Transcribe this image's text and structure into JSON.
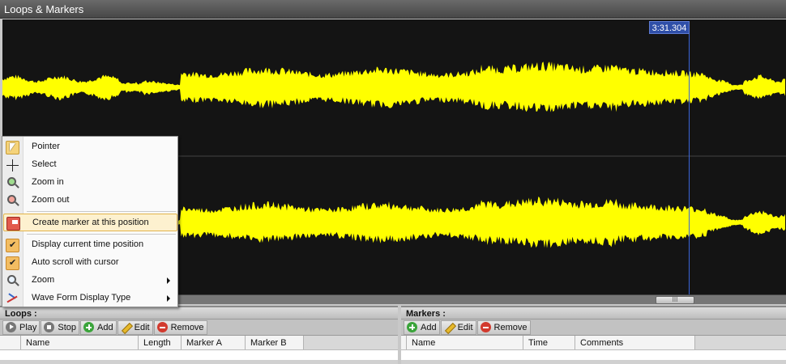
{
  "window": {
    "title": "Loops & Markers"
  },
  "waveform": {
    "color": "#ffff00",
    "background": "#141414",
    "cursor_color": "#3b66d8",
    "cursor_time": "3:31.304"
  },
  "context_menu": {
    "items": [
      {
        "label": "Pointer",
        "icon": "pointer-icon"
      },
      {
        "label": "Select",
        "icon": "crosshair-icon"
      },
      {
        "label": "Zoom in",
        "icon": "zoom-in-icon"
      },
      {
        "label": "Zoom out",
        "icon": "zoom-out-icon"
      },
      {
        "label": "Create marker at this position",
        "icon": "marker-icon",
        "highlighted": true
      },
      {
        "label": "Display current time position",
        "icon": "checkmark-icon",
        "checked": true
      },
      {
        "label": "Auto scroll with cursor",
        "icon": "checkmark-icon",
        "checked": true
      },
      {
        "label": "Zoom",
        "icon": "zoom-icon",
        "submenu": true
      },
      {
        "label": "Wave Form Display Type",
        "icon": "waveform-type-icon",
        "submenu": true
      }
    ]
  },
  "scrollbar": {
    "thumb_grip": "III"
  },
  "loops": {
    "title": "Loops :",
    "toolbar": {
      "play": "Play",
      "stop": "Stop",
      "add": "Add",
      "edit": "Edit",
      "remove": "Remove"
    },
    "columns": [
      "Name",
      "Length",
      "Marker A",
      "Marker B"
    ]
  },
  "markers": {
    "title": "Markers :",
    "toolbar": {
      "add": "Add",
      "edit": "Edit",
      "remove": "Remove"
    },
    "columns": [
      "Name",
      "Time",
      "Comments"
    ]
  }
}
